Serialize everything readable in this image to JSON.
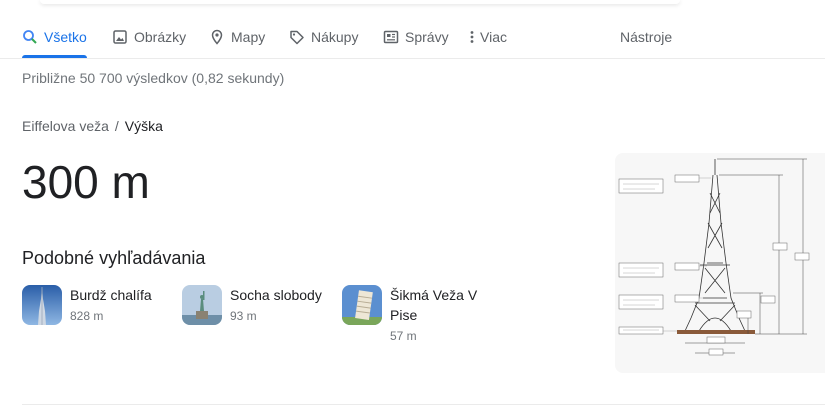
{
  "tabs": [
    {
      "label": "Všetko",
      "icon": "search-icon"
    },
    {
      "label": "Obrázky",
      "icon": "image-icon"
    },
    {
      "label": "Mapy",
      "icon": "map-pin-icon"
    },
    {
      "label": "Nákupy",
      "icon": "tag-icon"
    },
    {
      "label": "Správy",
      "icon": "news-icon"
    },
    {
      "label": "Viac",
      "icon": "more-vert-icon"
    }
  ],
  "tools_label": "Nástroje",
  "result_stats": "Približne 50 700 výsledkov (0,82 sekundy)",
  "breadcrumb": {
    "entity": "Eiffelova veža",
    "separator": "/",
    "attribute": "Výška"
  },
  "answer": "300 m",
  "related": {
    "heading": "Podobné vyhľadávania",
    "items": [
      {
        "name": "Burdž chalífa",
        "value": "828 m"
      },
      {
        "name": "Socha slobody",
        "value": "93 m"
      },
      {
        "name": "Šikmá Veža V Pise",
        "value": "57 m"
      }
    ]
  },
  "colors": {
    "accent": "#1a73e8",
    "text": "#202124",
    "muted": "#70757a"
  }
}
